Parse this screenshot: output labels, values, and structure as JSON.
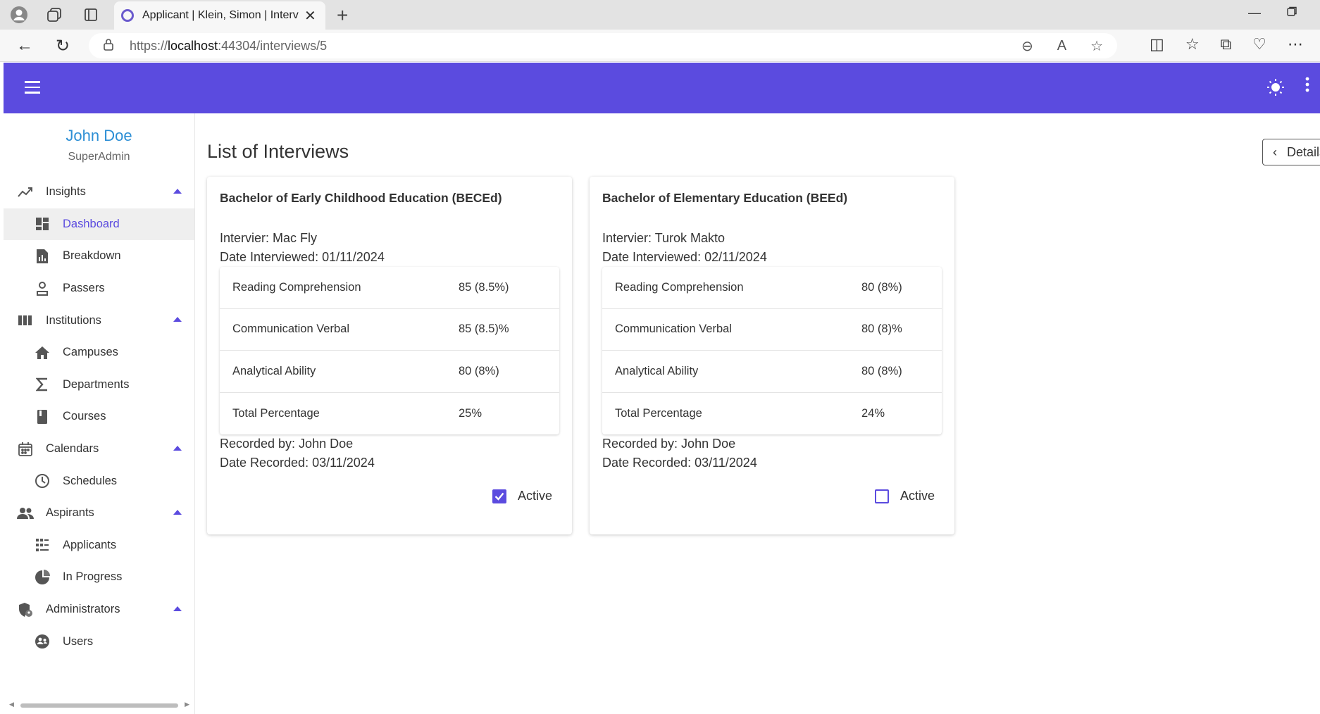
{
  "browser": {
    "tab_title": "Applicant | Klein, Simon | Interview",
    "url_prefix": "https://",
    "url_host": "localhost",
    "url_rest": ":44304/interviews/5"
  },
  "user": {
    "name": "John Doe",
    "role": "SuperAdmin"
  },
  "sidebar": {
    "items": [
      {
        "label": "Insights",
        "icon": "trending-up-icon",
        "type": "group"
      },
      {
        "label": "Dashboard",
        "icon": "dashboard-icon",
        "type": "sub",
        "active": true
      },
      {
        "label": "Breakdown",
        "icon": "file-chart-icon",
        "type": "sub"
      },
      {
        "label": "Passers",
        "icon": "badge-icon",
        "type": "sub"
      },
      {
        "label": "Institutions",
        "icon": "columns-icon",
        "type": "group"
      },
      {
        "label": "Campuses",
        "icon": "home-icon",
        "type": "sub"
      },
      {
        "label": "Departments",
        "icon": "sigma-icon",
        "type": "sub"
      },
      {
        "label": "Courses",
        "icon": "book-icon",
        "type": "sub"
      },
      {
        "label": "Calendars",
        "icon": "calendar-icon",
        "type": "group"
      },
      {
        "label": "Schedules",
        "icon": "clock-icon",
        "type": "sub"
      },
      {
        "label": "Aspirants",
        "icon": "people-icon",
        "type": "group"
      },
      {
        "label": "Applicants",
        "icon": "grid-list-icon",
        "type": "sub"
      },
      {
        "label": "In Progress",
        "icon": "pie-icon",
        "type": "sub"
      },
      {
        "label": "Administrators",
        "icon": "shield-user-icon",
        "type": "group"
      },
      {
        "label": "Users",
        "icon": "users-icon",
        "type": "sub"
      }
    ]
  },
  "main": {
    "title": "List of Interviews",
    "details_label": "Details",
    "interviews": [
      {
        "course": "Bachelor of Early Childhood Education (BECEd)",
        "interviewer": "Intervier: Mac Fly",
        "date_interviewed": "Date Interviewed: 01/11/2024",
        "scores": [
          {
            "name": "Reading Comprehension",
            "value": "85 (8.5%)"
          },
          {
            "name": "Communication Verbal",
            "value": "85 (8.5)%"
          },
          {
            "name": "Analytical Ability",
            "value": "80 (8%)"
          },
          {
            "name": "Total Percentage",
            "value": "25%"
          }
        ],
        "recorded_by": "Recorded by: John Doe",
        "date_recorded": "Date Recorded: 03/11/2024",
        "active_label": "Active",
        "active": true
      },
      {
        "course": "Bachelor of Elementary Education (BEEd)",
        "interviewer": "Intervier: Turok Makto",
        "date_interviewed": "Date Interviewed: 02/11/2024",
        "scores": [
          {
            "name": "Reading Comprehension",
            "value": "80 (8%)"
          },
          {
            "name": "Communication Verbal",
            "value": "80 (8)%"
          },
          {
            "name": "Analytical Ability",
            "value": "80 (8%)"
          },
          {
            "name": "Total Percentage",
            "value": "24%"
          }
        ],
        "recorded_by": "Recorded by: John Doe",
        "date_recorded": "Date Recorded: 03/11/2024",
        "active_label": "Active",
        "active": false
      }
    ]
  }
}
